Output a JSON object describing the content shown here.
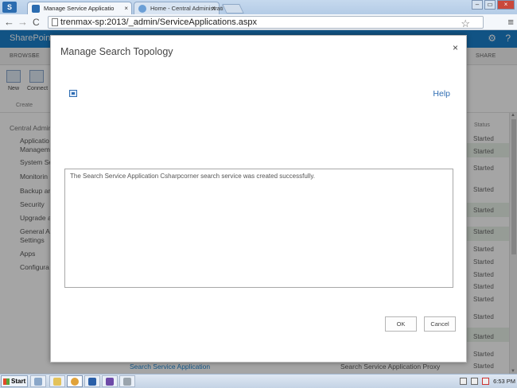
{
  "browser": {
    "tabs": [
      {
        "label": "Manage Service Applicatio",
        "active": true
      },
      {
        "label": "Home - Central Administrati",
        "active": false
      }
    ],
    "url": "trenmax-sp:2013/_admin/ServiceApplications.aspx",
    "tab_close_glyph": "×",
    "back_glyph": "←",
    "forward_glyph": "→",
    "reload_glyph": "C",
    "star_glyph": "☆",
    "menu_glyph": "≡",
    "window_controls": [
      "–",
      "▭",
      "×"
    ]
  },
  "sharepoint": {
    "brand": "SharePoint",
    "gear_glyph": "⚙",
    "help_glyph": "?",
    "ribbon_tabs": [
      "BROWSE",
      "SE"
    ],
    "share_label": "SHARE",
    "ribbon_buttons": [
      {
        "label": "New"
      },
      {
        "label": "Connect"
      }
    ],
    "ribbon_group": "Create",
    "left_nav": {
      "heading": "Central Admin",
      "items": [
        "Applicatio",
        "Managem",
        "System Se",
        "Monitorin",
        "Backup an",
        "Security",
        "Upgrade a",
        "General A",
        "Settings",
        "Apps",
        "Configura"
      ]
    },
    "status_header": "Status",
    "status_values": [
      "Started",
      "Started",
      "Started",
      "Started",
      "Started",
      "Started",
      "Started",
      "Started",
      "Started",
      "Started",
      "Started",
      "Started",
      "Started",
      "Started",
      "Started",
      "Started"
    ],
    "bottom_row": {
      "name": "Search Service Application",
      "type": "Search Service Application Proxy",
      "status": "Started"
    }
  },
  "dialog": {
    "title": "Manage Search Topology",
    "close_glyph": "×",
    "help_label": "Help",
    "message": "The Search Service Application Csharpcorner search service was created successfully.",
    "ok_label": "OK",
    "cancel_label": "Cancel"
  },
  "taskbar": {
    "start_label": "Start",
    "time": "6:53 PM"
  }
}
